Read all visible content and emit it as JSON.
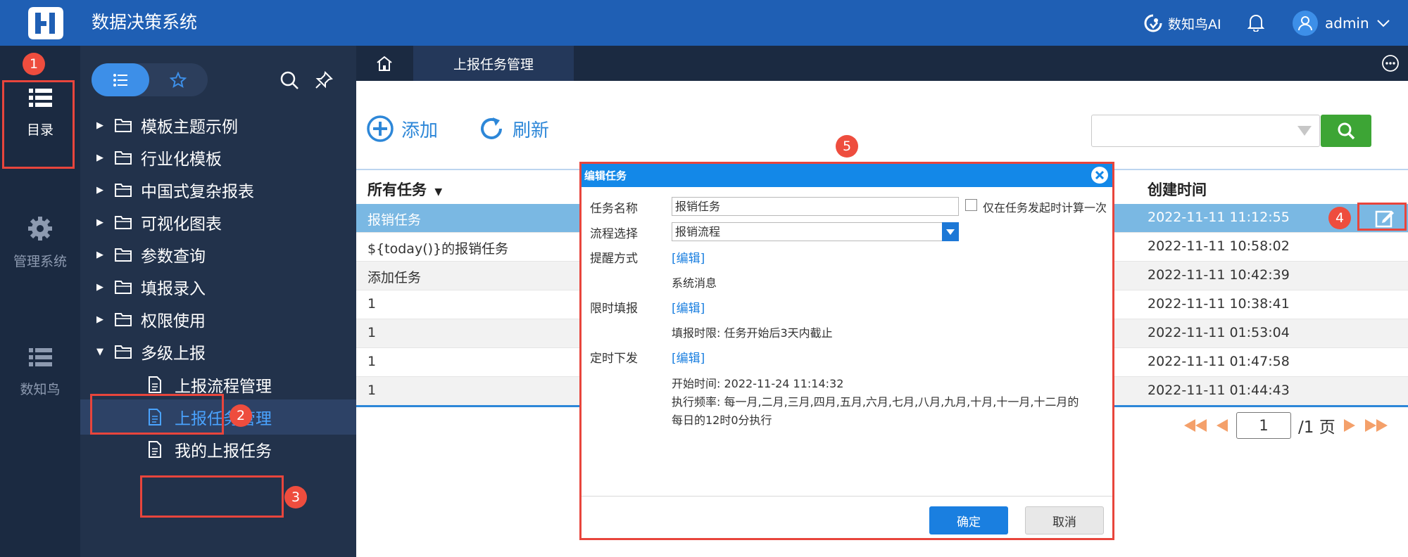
{
  "header": {
    "app_title": "数据决策系统",
    "ai_label": "数知鸟AI",
    "user_name": "admin"
  },
  "rail": {
    "items": [
      {
        "label": "目录"
      },
      {
        "label": "管理系统"
      },
      {
        "label": "数知鸟"
      }
    ]
  },
  "tree": {
    "nodes": [
      {
        "label": "模板主题示例"
      },
      {
        "label": "行业化模板"
      },
      {
        "label": "中国式复杂报表"
      },
      {
        "label": "可视化图表"
      },
      {
        "label": "参数查询"
      },
      {
        "label": "填报录入"
      },
      {
        "label": "权限使用"
      },
      {
        "label": "多级上报"
      }
    ],
    "children": [
      {
        "label": "上报流程管理"
      },
      {
        "label": "上报任务管理"
      },
      {
        "label": "我的上报任务"
      }
    ]
  },
  "tabs": {
    "active_label": "上报任务管理"
  },
  "toolbar": {
    "add_label": "添加",
    "refresh_label": "刷新",
    "search_value": ""
  },
  "table": {
    "col_task": "所有任务",
    "col_created": "创建时间",
    "rows": [
      {
        "name": "报销任务",
        "created": "2022-11-11 11:12:55"
      },
      {
        "name": "${today()}的报销任务",
        "created": "2022-11-11 10:58:02"
      },
      {
        "name": "添加任务",
        "created": "2022-11-11 10:42:39"
      },
      {
        "name": "1",
        "created": "2022-11-11 10:38:41"
      },
      {
        "name": "1",
        "created": "2022-11-11 01:53:04"
      },
      {
        "name": "1",
        "created": "2022-11-11 01:47:58"
      },
      {
        "name": "1",
        "created": "2022-11-11 01:44:43"
      }
    ]
  },
  "pager": {
    "current": "1",
    "total_label": "/1 页"
  },
  "dialog": {
    "title": "编辑任务",
    "name_label": "任务名称",
    "name_value": "报销任务",
    "once_label": "仅在任务发起时计算一次",
    "flow_label": "流程选择",
    "flow_value": "报销流程",
    "remind_label": "提醒方式",
    "remind_edit": "[编辑]",
    "remind_value": "系统消息",
    "limit_label": "限时填报",
    "limit_edit": "[编辑]",
    "limit_value": "填报时限: 任务开始后3天内截止",
    "schedule_label": "定时下发",
    "schedule_edit": "[编辑]",
    "schedule_start": "开始时间: 2022-11-24 11:14:32",
    "schedule_freq": "执行频率: 每一月,二月,三月,四月,五月,六月,七月,八月,九月,十月,十一月,十二月的",
    "schedule_daily": "每日的12时0分执行",
    "ok_label": "确定",
    "cancel_label": "取消"
  },
  "annotations": {
    "badges": [
      "1",
      "2",
      "3",
      "4",
      "5"
    ]
  },
  "colors": {
    "topbar": "#1f5fb4",
    "rail": "#1b2a41",
    "tree": "#22324b",
    "accent": "#3d8fe8",
    "highlight": "#e8453c",
    "selected_row": "#7ab8e3",
    "search_button": "#3da535"
  }
}
